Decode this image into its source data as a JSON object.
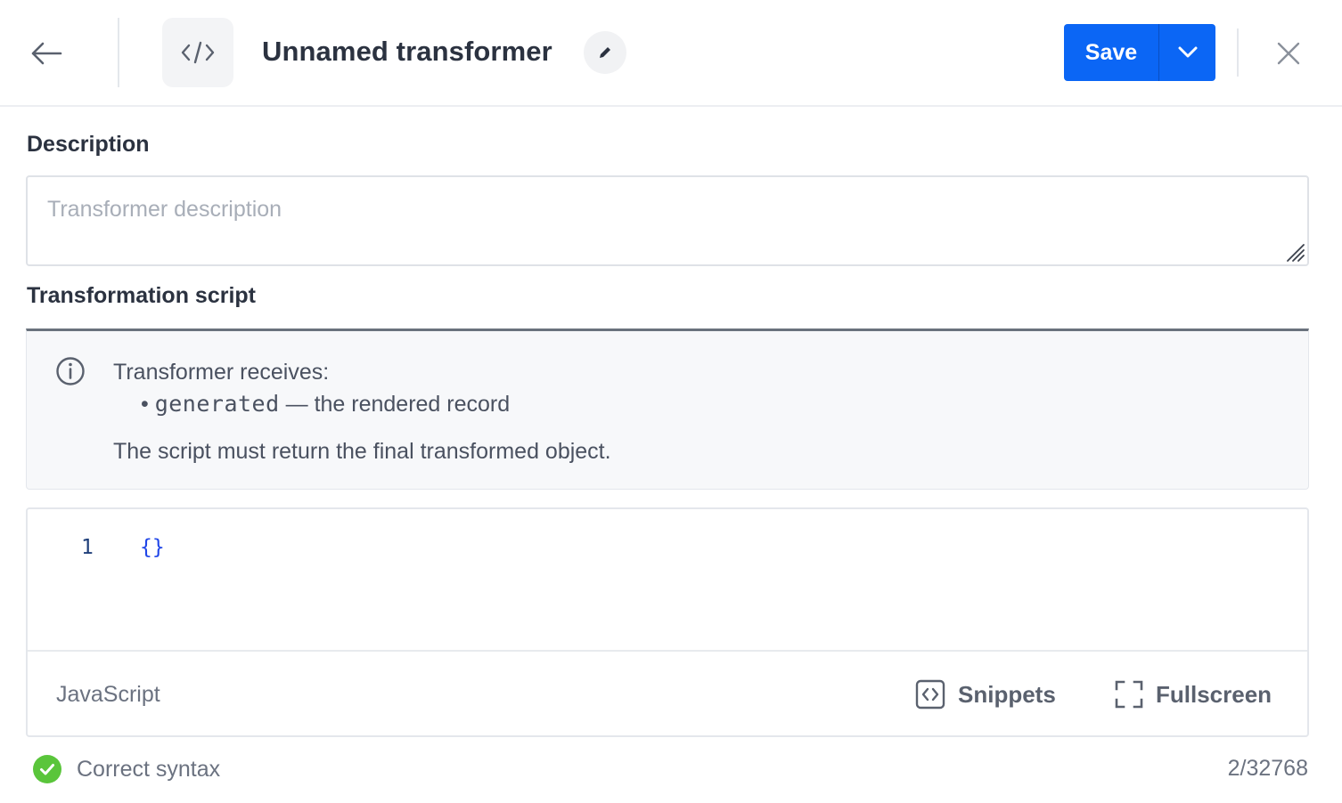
{
  "header": {
    "title": "Unnamed transformer",
    "save_label": "Save",
    "accent_color": "#0b66f5"
  },
  "description": {
    "label": "Description",
    "placeholder": "Transformer description",
    "value": ""
  },
  "script": {
    "label": "Transformation script",
    "info": {
      "intro": "Transformer receives:",
      "bullet_code": "generated",
      "bullet_text": " — the rendered record",
      "outro": "The script must return the final transformed object."
    },
    "editor": {
      "line_number": "1",
      "code": "{}",
      "language": "JavaScript",
      "snippets_label": "Snippets",
      "fullscreen_label": "Fullscreen"
    }
  },
  "status": {
    "text": "Correct syntax",
    "counter": "2/32768",
    "color": "#5ac53b"
  },
  "icons": [
    "arrow-left-icon",
    "code-icon",
    "pencil-icon",
    "chevron-down-icon",
    "close-icon",
    "info-icon",
    "resize-handle-icon",
    "snippets-icon",
    "fullscreen-icon",
    "check-circle-icon"
  ]
}
